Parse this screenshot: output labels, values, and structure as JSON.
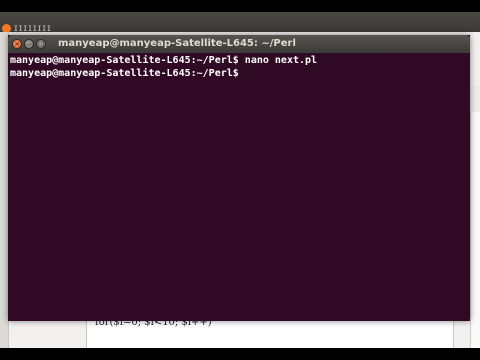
{
  "background_app": {
    "title_fragment": "ɪɪɪɪɪɪɪɪ",
    "code_line": "for($i=0; $i<10; $i++)"
  },
  "terminal": {
    "title": "manyeap@manyeap-Satellite-L645: ~/Perl",
    "lines": [
      "manyeap@manyeap-Satellite-L645:~/Perl$ nano next.pl",
      "manyeap@manyeap-Satellite-L645:~/Perl$ "
    ],
    "buttons": {
      "close": "×",
      "minimize": "–",
      "maximize": "□"
    }
  },
  "colors": {
    "terminal_bg": "#300a24",
    "titlebar": "#3c3b37",
    "close_button": "#e0511d"
  }
}
